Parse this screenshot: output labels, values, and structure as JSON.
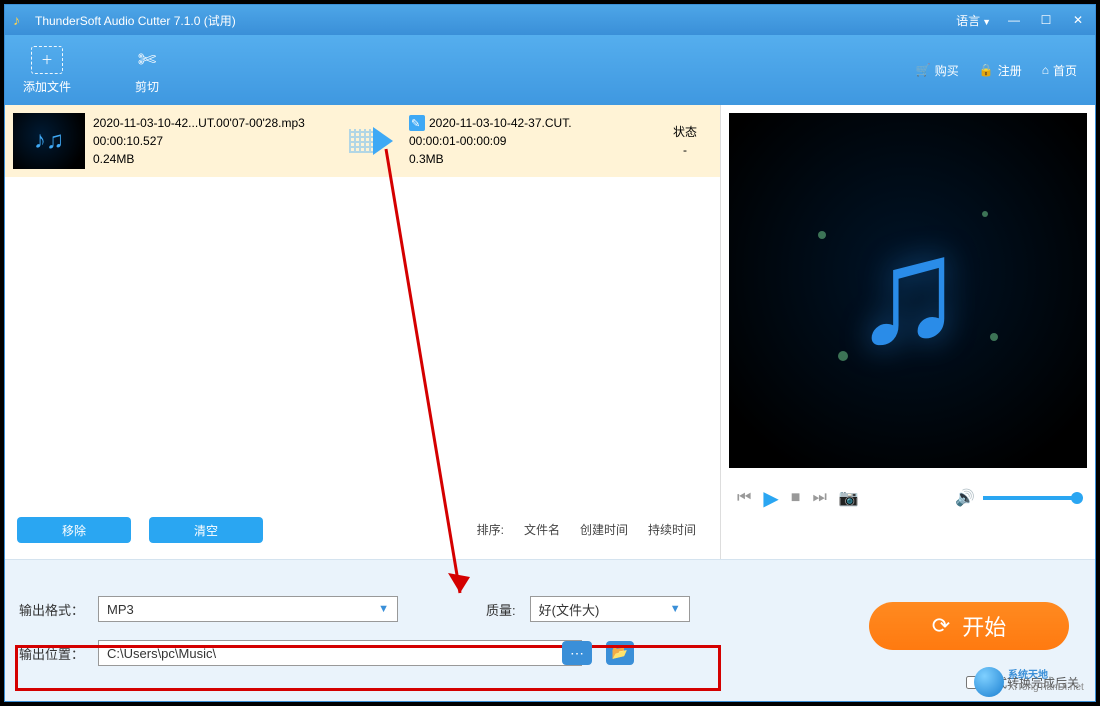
{
  "titlebar": {
    "app_title": "ThunderSoft Audio Cutter 7.1.0 (试用)",
    "language": "语言"
  },
  "toolbar": {
    "add_files": "添加文件",
    "cut": "剪切",
    "buy": "购买",
    "register": "注册",
    "home": "首页"
  },
  "file_row": {
    "src_name": "2020-11-03-10-42...UT.00'07-00'28.mp3",
    "src_duration": "00:00:10.527",
    "src_size": "0.24MB",
    "out_name": "2020-11-03-10-42-37.CUT.",
    "out_range": "00:00:01-00:00:09",
    "out_size": "0.3MB",
    "status_header": "状态",
    "status_value": "-"
  },
  "list_actions": {
    "remove": "移除",
    "clear": "清空",
    "sort_label": "排序:",
    "sort_filename": "文件名",
    "sort_ctime": "创建时间",
    "sort_duration": "持续时间"
  },
  "bottom": {
    "format_label": "输出格式：",
    "format_value": "MP3",
    "quality_label": "质量:",
    "quality_value": "好(文件大)",
    "path_label": "输出位置：",
    "path_value": "C:\\Users\\pc\\Music\\",
    "start": "开始",
    "shutdown": "格式转换完成后关"
  },
  "watermark": {
    "line1": "系统天地",
    "line2": "XiTongTianDi.net"
  }
}
